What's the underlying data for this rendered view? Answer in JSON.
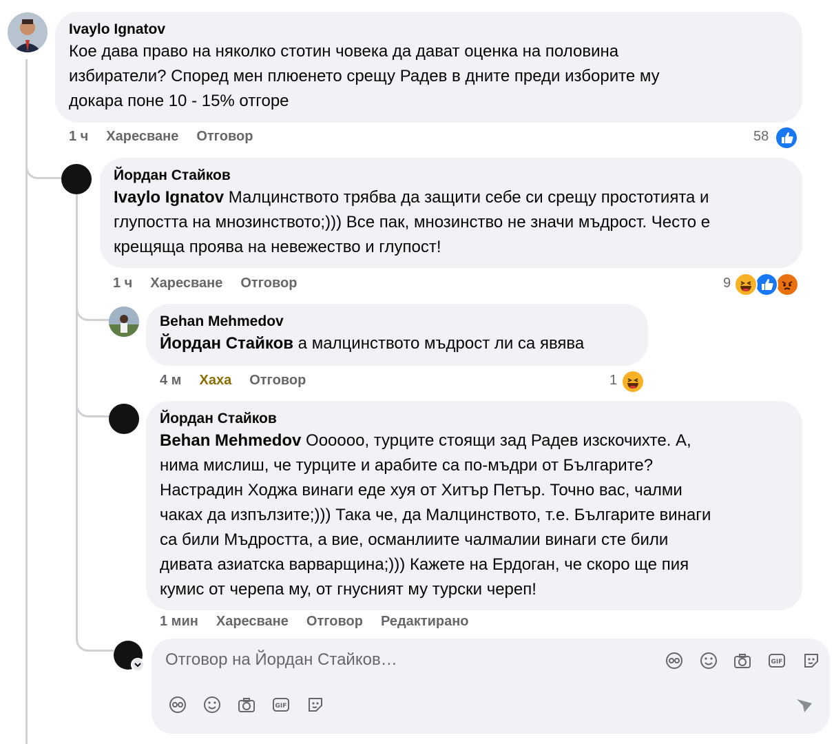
{
  "comments": [
    {
      "author": "Ivaylo Ignatov",
      "mention": "",
      "text_lines": [
        "Кое дава право на няколко стотин човека да дават оценка на половина",
        "избиратели? Според мен плюенето срещу Радев в дните преди изборите му",
        "докара поне 10 - 15% отгоре"
      ],
      "time": "1 ч",
      "like": "Харесване",
      "reply": "Отговор",
      "reactions": "58"
    },
    {
      "author": "Йордан Стайков",
      "mention": "Ivaylo Ignatov",
      "text_lines": [
        " Малцинството трябва да защити себе си срещу простотията и",
        "глупостта на мнозинството;))) Все пак, мнозинство не значи мъдрост. Често е",
        "крещяща проява на невежество и глупост!"
      ],
      "time": "1 ч",
      "like": "Харесване",
      "reply": "Отговор",
      "reactions": "9"
    },
    {
      "author": "Behan Mehmedov",
      "mention": "Йордан Стайков",
      "text_lines": [
        " а малцинството мъдрост ли са явява"
      ],
      "time": "4 м",
      "like": "Хаха",
      "reply": "Отговор",
      "reactions": "1"
    },
    {
      "author": "Йордан Стайков",
      "mention": "Behan Mehmedov",
      "text_lines": [
        " Ооoooo, турците стоящи зад Радев изскочихте. А,",
        "нима мислиш, че турците и арабите са по-мъдри от Българите?",
        "Настрадин Ходжа винаги еде хуя от Хитър Петър. Точно вас, чалми",
        "чаках да изпълзите;))) Така че, да Малцинството, т.е. Българите винаги",
        "са били Мъдростта, а вие, османлиите чалмалии винаги сте били",
        "дивата азиатска варварщина;))) Кажете на Ердоган, че скоро ще пия",
        "кумис от черепа му, от гнусният му турски череп!"
      ],
      "time": "1 мин",
      "like": "Харесване",
      "reply": "Отговор",
      "edited": "Редактирано"
    }
  ],
  "composer": {
    "placeholder": "Отговор на Йордан Стайков…",
    "tools": [
      "avatar-sticker-icon",
      "emoji-icon",
      "camera-icon",
      "gif-icon",
      "sticker-icon"
    ],
    "send": "send-icon"
  },
  "colors": {
    "bubble": "#f0f2f5",
    "like": "#1877f2",
    "haha_active": "#8a6d00",
    "meta": "#65676b"
  }
}
